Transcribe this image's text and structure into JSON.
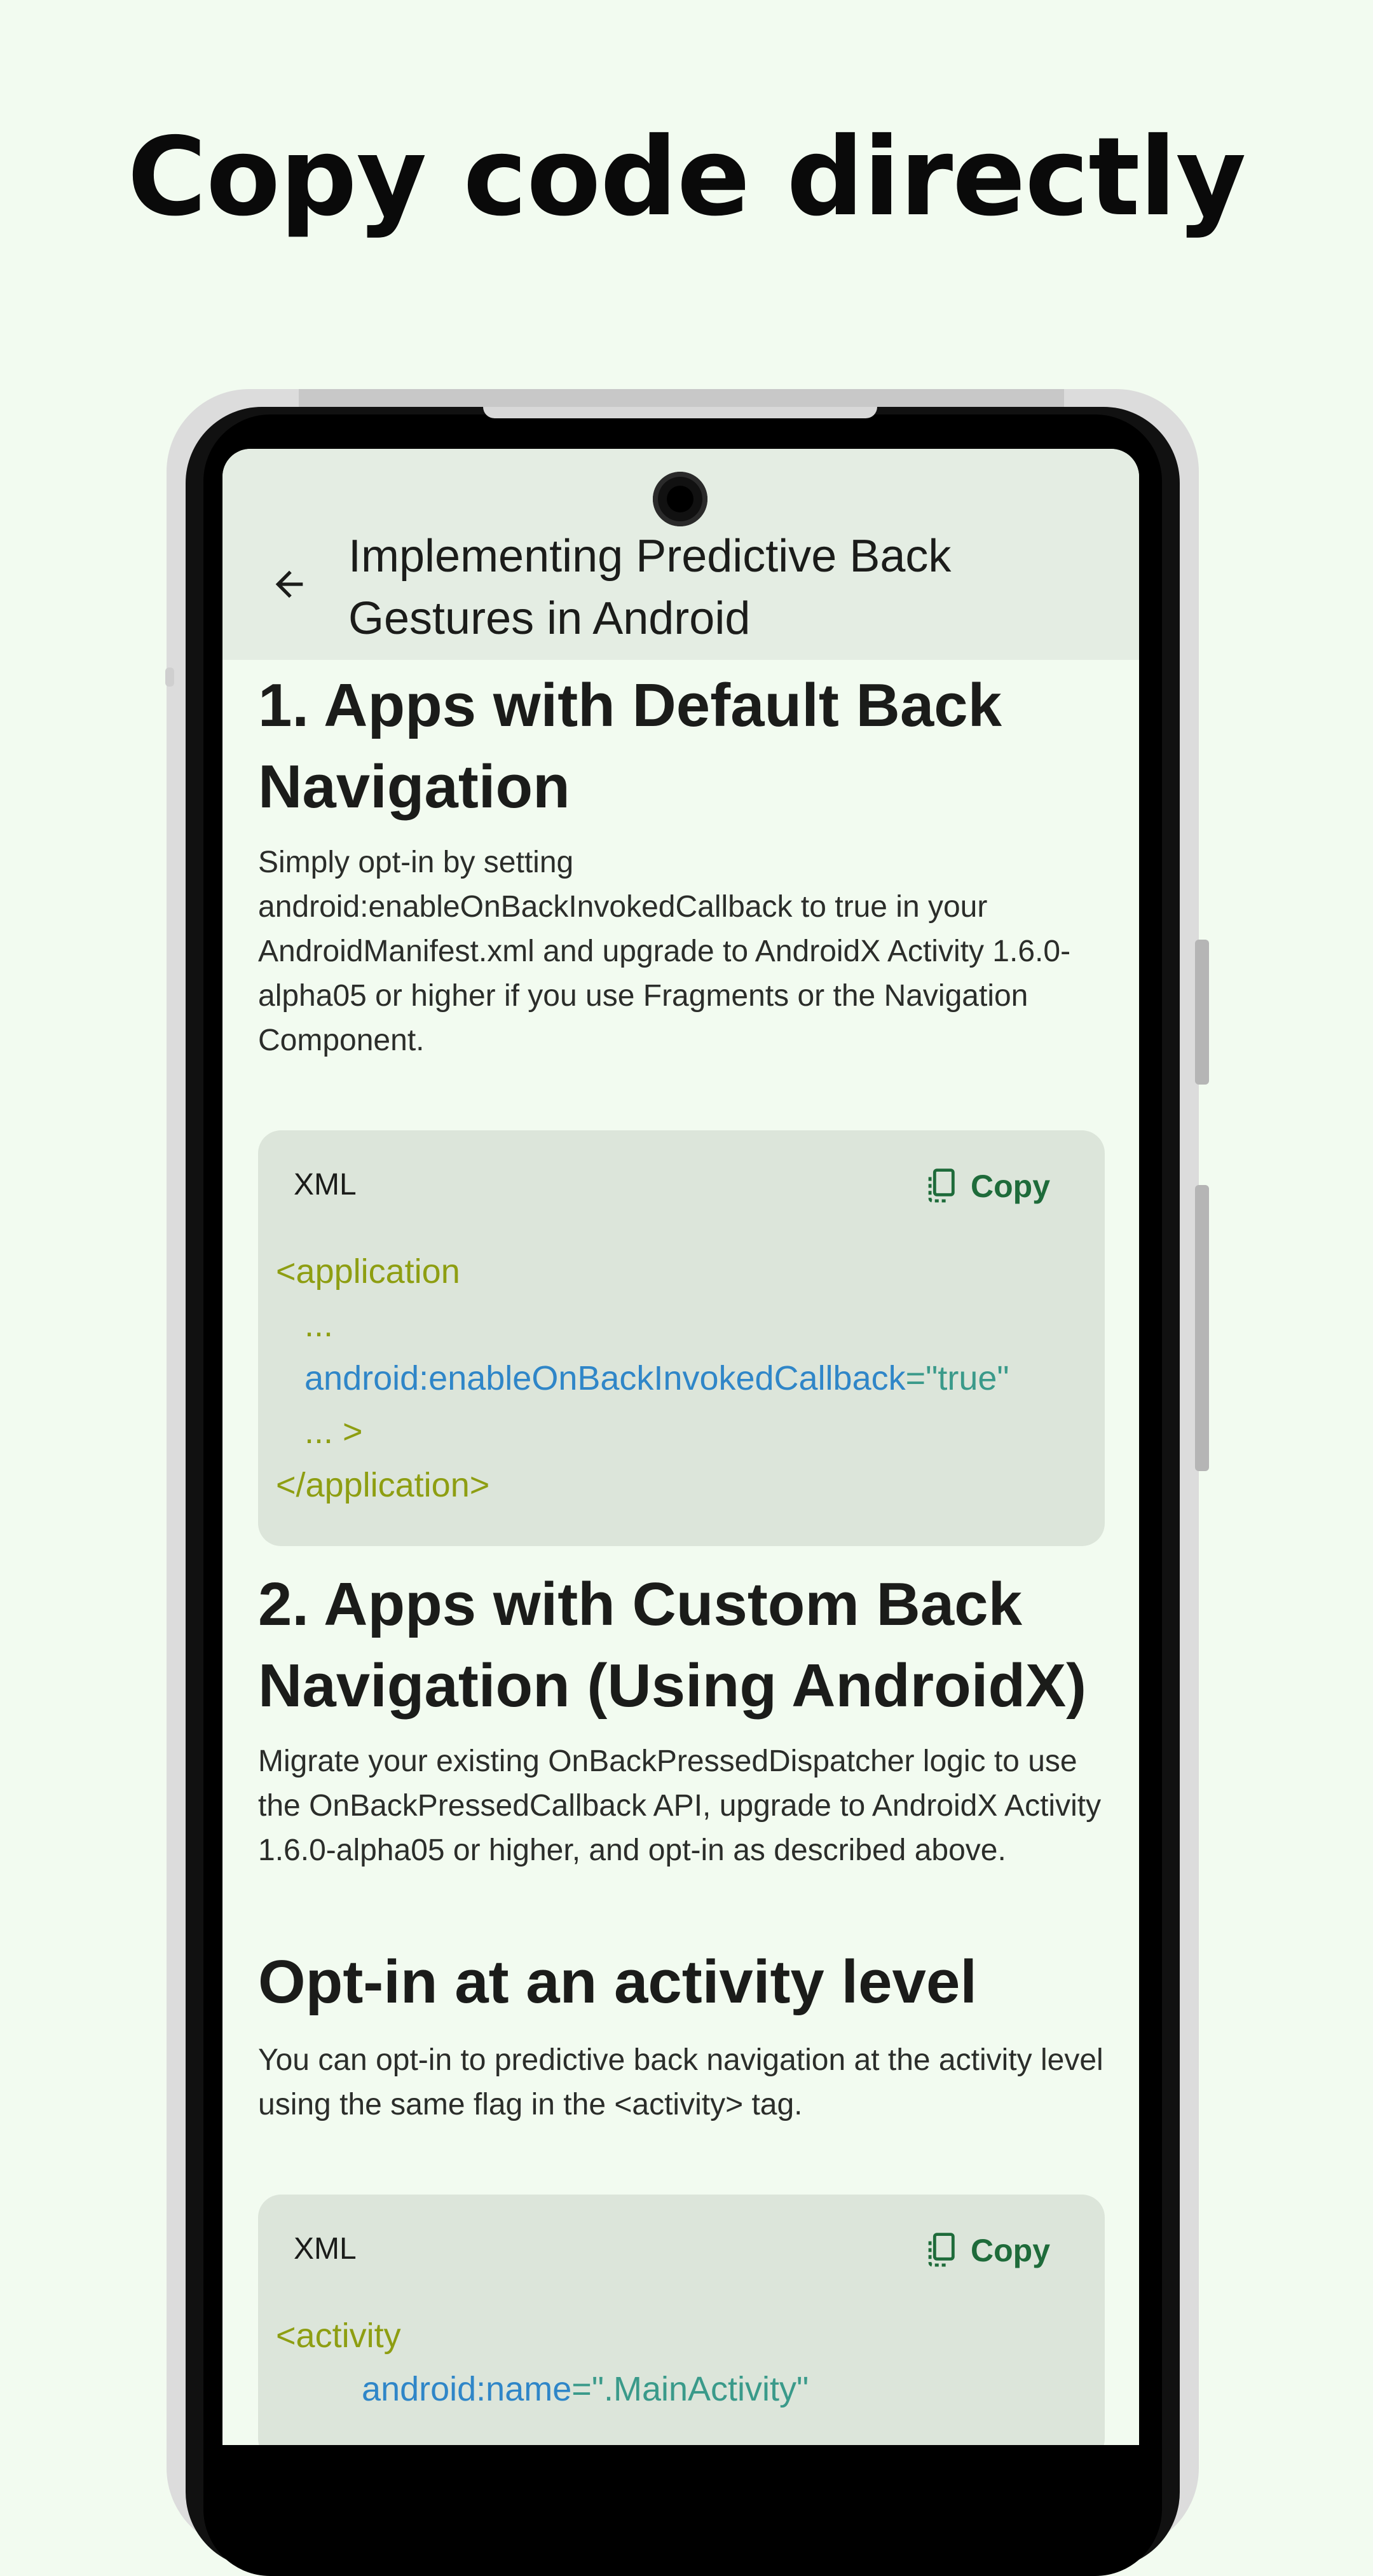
{
  "headline": "Copy code directly",
  "appbar": {
    "title": "Implementing Predictive Back Gestures in Android",
    "back_icon": "arrow-back-icon"
  },
  "sections": [
    {
      "heading": "1. Apps with Default Back Navigation",
      "body": "Simply opt-in by setting android:enableOnBackInvokedCallback to true in your AndroidManifest.xml and upgrade to AndroidX Activity 1.6.0-alpha05 or higher if you use Fragments or the Navigation Component."
    },
    {
      "heading": "2. Apps with Custom Back Navigation (Using AndroidX)",
      "body": "Migrate your existing OnBackPressedDispatcher logic to use the OnBackPressedCallback API, upgrade to AndroidX Activity 1.6.0-alpha05 or higher, and opt-in as described above."
    },
    {
      "heading": "Opt-in at an activity level",
      "body": "You can opt-in to predictive back navigation at the activity level using the same flag in the <activity> tag."
    }
  ],
  "code_blocks": [
    {
      "language": "XML",
      "copy_label": "Copy",
      "lines": {
        "l1": "<application",
        "l2": "...",
        "l3_attr": "android:enableOnBackInvokedCallback",
        "l3_eq": "=",
        "l3_val": "\"true\"",
        "l4": "... >",
        "l5": "</application>"
      }
    },
    {
      "language": "XML",
      "copy_label": "Copy",
      "lines": {
        "l1": "<activity",
        "l2_attr": "android:name",
        "l2_eq": "=",
        "l2_val": "\".MainActivity\""
      }
    }
  ],
  "colors": {
    "background": "#f2fbf0",
    "appbar": "#e4ede3",
    "code_card": "#dce5da",
    "copy_accent": "#1e6b3a",
    "code_tag": "#8e9e12",
    "code_attr": "#2f86c8",
    "code_string": "#3a9a8a"
  }
}
